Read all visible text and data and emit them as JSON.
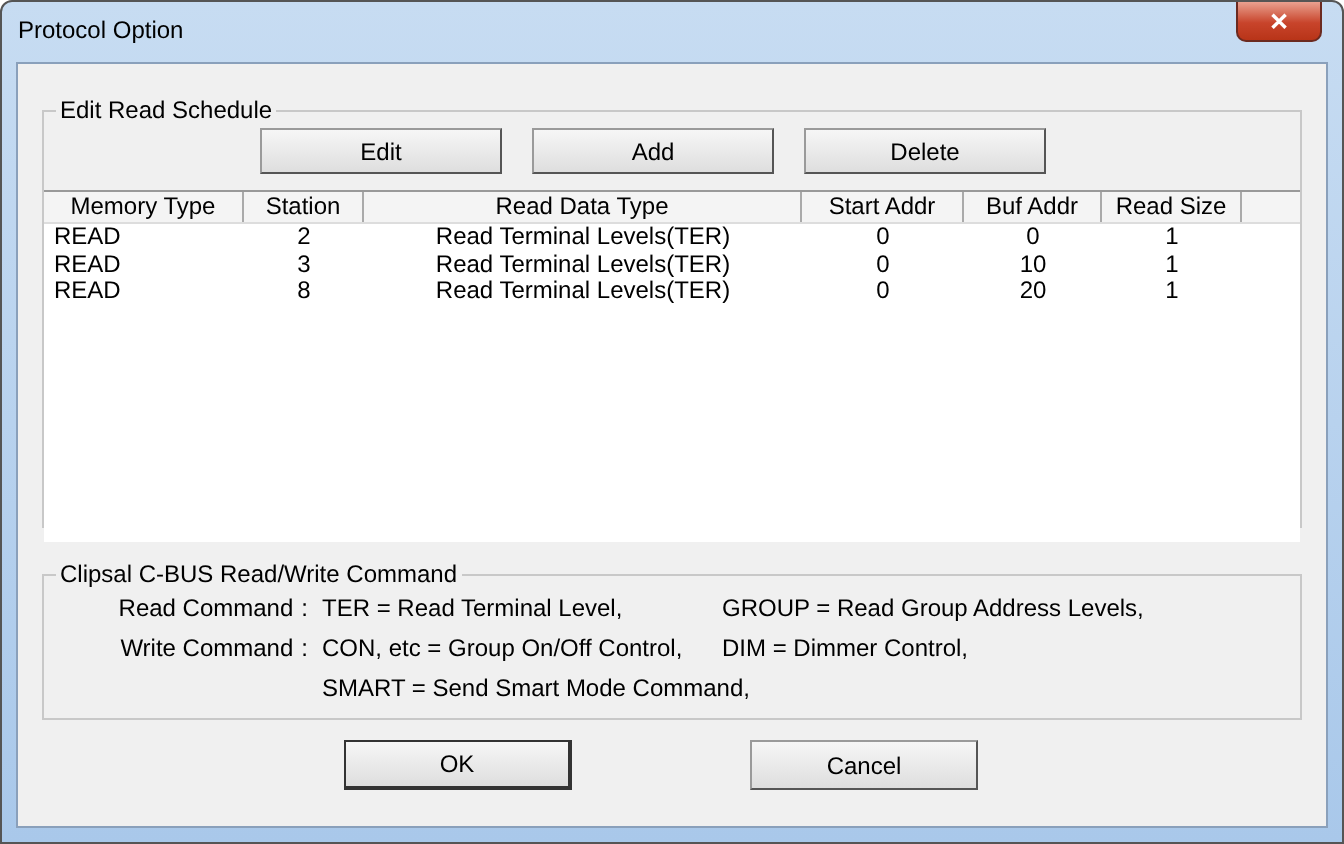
{
  "window": {
    "title": "Protocol Option",
    "close": "✕"
  },
  "schedule": {
    "title": "Edit Read Schedule",
    "buttons": [
      "Edit",
      "Add",
      "Delete"
    ],
    "columns": [
      "Memory Type",
      "Station",
      "Read Data Type",
      "Start Addr",
      "Buf Addr",
      "Read Size"
    ],
    "rows": [
      {
        "cells": [
          "READ",
          "2",
          "Read Terminal Levels(TER)",
          "0",
          "0",
          "1"
        ]
      },
      {
        "cells": [
          "READ",
          "3",
          "Read Terminal Levels(TER)",
          "0",
          "10",
          "1"
        ]
      },
      {
        "cells": [
          "READ",
          "8",
          "Read Terminal Levels(TER)",
          "0",
          "20",
          "1"
        ]
      }
    ]
  },
  "commands": {
    "title": "Clipsal C-BUS Read/Write Command",
    "lines": [
      {
        "label": "Read Command",
        "sep": ":",
        "items": [
          "TER = Read Terminal Level,",
          "GROUP = Read Group Address Levels,"
        ]
      },
      {
        "label": "Write Command",
        "sep": ":",
        "items": [
          "CON, etc = Group On/Off Control,",
          "DIM = Dimmer Control,"
        ]
      },
      {
        "items": [
          "SMART = Send Smart Mode Command,"
        ]
      }
    ]
  },
  "buttons": [
    "OK",
    "Cancel"
  ]
}
